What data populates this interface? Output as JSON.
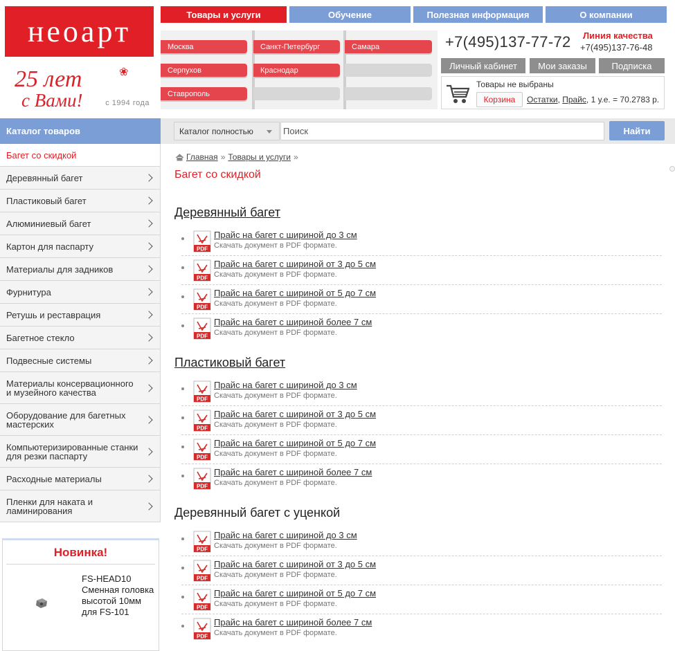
{
  "logo": {
    "text": "неоарт",
    "slogan_line1": "25 лет",
    "slogan_line2": "с Вами!",
    "since": "с 1994 года"
  },
  "top_nav": [
    {
      "label": "Товары и услуги",
      "active": true
    },
    {
      "label": "Обучение",
      "active": false
    },
    {
      "label": "Полезная информация",
      "active": false
    },
    {
      "label": "О компании",
      "active": false
    }
  ],
  "cities": [
    "Москва",
    "Санкт-Петербург",
    "Самара",
    "Серпухов",
    "Краснодар",
    "Ставрополь"
  ],
  "contacts": {
    "phone": "+7(495)137-77-72",
    "quality_title": "Линия качества",
    "quality_phone": "+7(495)137-76-48"
  },
  "user_buttons": [
    "Личный кабинет",
    "Мои заказы",
    "Подписка"
  ],
  "cart": {
    "status": "Товары не выбраны",
    "button": "Корзина",
    "link_stock": "Остатки",
    "link_price": "Прайс",
    "rate_text": ", 1 у.е. = 70.2783 р."
  },
  "catalog_header": "Каталог товаров",
  "search": {
    "scope": "Каталог полностью",
    "placeholder": "Поиск",
    "button": "Найти"
  },
  "sidebar": [
    {
      "label": "Багет со скидкой",
      "active": true
    },
    {
      "label": "Деревянный багет"
    },
    {
      "label": "Пластиковый багет"
    },
    {
      "label": "Алюминиевый багет"
    },
    {
      "label": "Картон для паспарту"
    },
    {
      "label": "Материалы для задников"
    },
    {
      "label": "Фурнитура"
    },
    {
      "label": "Ретушь и реставрация"
    },
    {
      "label": "Багетное стекло"
    },
    {
      "label": "Подвесные системы"
    },
    {
      "label": "Материалы консервационного и музейного качества"
    },
    {
      "label": "Оборудование для багетных мастерских"
    },
    {
      "label": "Компьютеризированные станки для резки паспарту"
    },
    {
      "label": "Расходные материалы"
    },
    {
      "label": "Пленки для наката и ламинирования"
    }
  ],
  "new_box": {
    "title": "Новинка!",
    "product": "FS-HEAD10 Сменная головка высотой 10мм для FS-101"
  },
  "breadcrumb": {
    "home": "Главная",
    "section": "Товары и услуги",
    "sep": "»"
  },
  "page_title": "Багет со скидкой",
  "doc_desc": "Скачать документ в PDF формате.",
  "sections": [
    {
      "title": "Деревянный багет",
      "items": [
        "Прайс на багет с шириной до 3 см",
        "Прайс на багет с шириной от 3 до 5 см",
        "Прайс на багет с шириной от 5 до 7 см",
        "Прайс на багет с шириной более 7 см"
      ]
    },
    {
      "title": "Пластиковый багет",
      "items": [
        "Прайс на багет с шириной до 3 см",
        "Прайс на багет с шириной от 3 до 5 см",
        "Прайс на багет с шириной от 5 до 7 см",
        "Прайс на багет с шириной более 7 см"
      ]
    },
    {
      "title": "Деревянный багет с уценкой",
      "items": [
        "Прайс на багет с шириной до 3 см",
        "Прайс на багет с шириной от 3 до 5 см",
        "Прайс на багет с шириной от 5 до 7 см",
        "Прайс на багет с шириной более 7 см"
      ]
    }
  ],
  "colors": {
    "brand_red": "#e01f26",
    "nav_blue": "#7b9ed6",
    "button_grey": "#8e8e8e"
  }
}
